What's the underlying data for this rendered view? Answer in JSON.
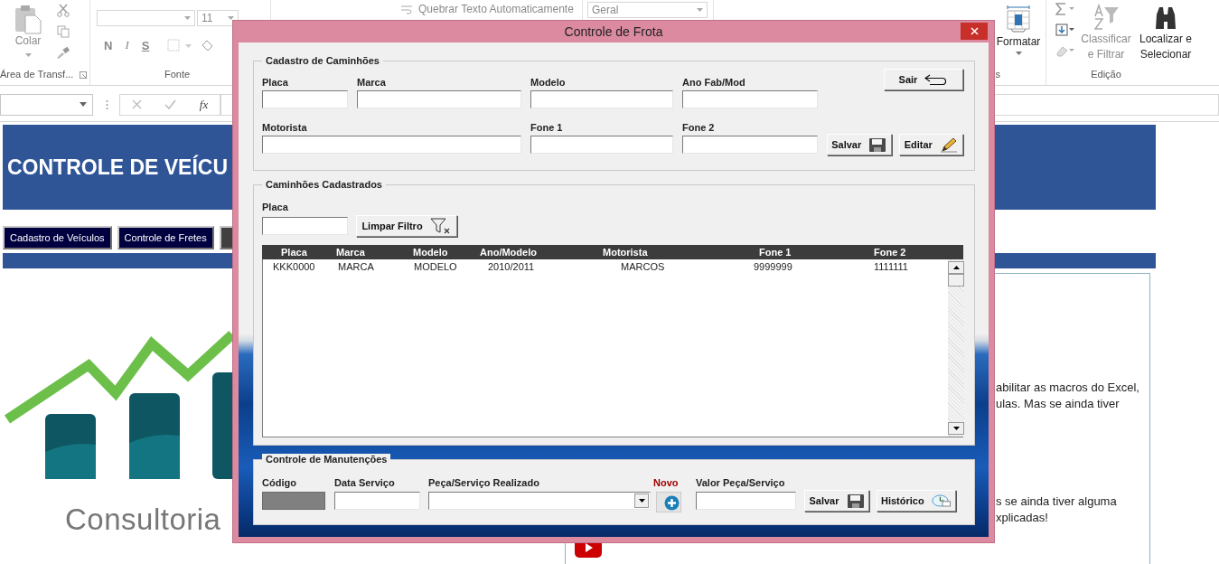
{
  "ribbon": {
    "clipboard": {
      "paste": "Colar",
      "group_label": "Área de Transf..."
    },
    "font": {
      "size": "11",
      "bold": "N",
      "italic": "I",
      "underline": "S",
      "group_label": "Fonte"
    },
    "alignment": {
      "wrap_text": "Quebrar Texto Automaticamente"
    },
    "number": {
      "format": "Geral"
    },
    "cells": {
      "format": "Formatar",
      "group_label": "s"
    },
    "editing": {
      "sort_filter": [
        "Classificar",
        "e Filtrar"
      ],
      "find_select": [
        "Localizar e",
        "Selecionar"
      ],
      "group_label": "Edição"
    }
  },
  "formula_bar": {
    "function_label": "fx"
  },
  "sheet": {
    "title": "CONTROLE DE VEÍCU",
    "nav_buttons": [
      {
        "label": "Cadastro de Veículos"
      },
      {
        "label": "Controle de Fretes"
      }
    ],
    "logo_text": "Consultoria",
    "info_paragraphs": [
      [
        "abilitar as macros do Excel,",
        "ulas. Mas se ainda tiver"
      ],
      [
        "s se ainda tiver alguma",
        "xplicadas!"
      ]
    ]
  },
  "dialog": {
    "title": "Controle de Frota",
    "registration": {
      "title": "Cadastro de Caminhões",
      "fields": [
        {
          "label": "Placa"
        },
        {
          "label": "Marca"
        },
        {
          "label": "Modelo"
        },
        {
          "label": "Ano Fab/Mod"
        },
        {
          "label": "Motorista"
        },
        {
          "label": "Fone 1"
        },
        {
          "label": "Fone 2"
        }
      ],
      "exit_button": "Sair",
      "save_button": "Salvar",
      "edit_button": "Editar"
    },
    "registered": {
      "title": "Caminhões Cadastrados",
      "filter_label": "Placa",
      "clear_filter_button": "Limpar Filtro",
      "table": {
        "columns": [
          "Placa",
          "Marca",
          "Modelo",
          "Ano/Modelo",
          "Motorista",
          "Fone 1",
          "Fone 2"
        ],
        "rows": [
          [
            "KKK0000",
            "MARCA",
            "MODELO",
            "2010/2011",
            "MARCOS",
            "9999999",
            "1111111"
          ]
        ]
      }
    },
    "maintenance": {
      "title": "Controle de Manutenções",
      "fields": [
        {
          "label": "Código",
          "kind": "text",
          "disabled": true
        },
        {
          "label": "Data Serviço",
          "kind": "text",
          "disabled": false
        },
        {
          "label": "Peça/Serviço Realizado",
          "kind": "combo",
          "disabled": false
        }
      ],
      "new_label": "Novo",
      "value_field": {
        "label": "Valor Peça/Serviço"
      },
      "save_button": "Salvar",
      "history_button": "Histórico"
    }
  }
}
